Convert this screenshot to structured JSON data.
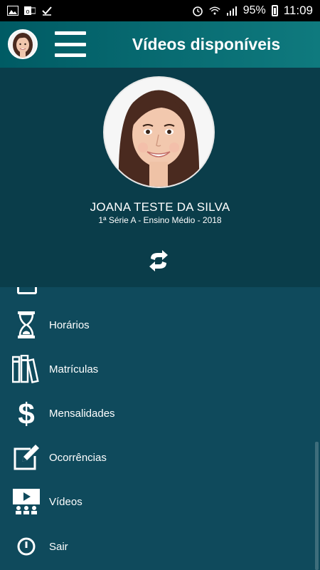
{
  "status_bar": {
    "battery": "95%",
    "time": "11:09",
    "left_icons": [
      "image-icon",
      "outlook-icon",
      "check-icon"
    ],
    "right_icons": [
      "alarm-icon",
      "wifi-icon",
      "signal-icon",
      "battery-icon"
    ]
  },
  "header": {
    "title": "Vídeos disponíveis"
  },
  "profile": {
    "name": "JOANA TESTE DA SILVA",
    "details": "1ª Série A - Ensino Médio - 2018"
  },
  "menu": {
    "items": [
      {
        "label": "Horários",
        "icon": "hourglass-icon"
      },
      {
        "label": "Matrículas",
        "icon": "books-icon"
      },
      {
        "label": "Mensalidades",
        "icon": "dollar-icon"
      },
      {
        "label": "Ocorrências",
        "icon": "edit-icon"
      },
      {
        "label": "Vídeos",
        "icon": "video-icon"
      },
      {
        "label": "Sair",
        "icon": "power-icon"
      }
    ]
  },
  "colors": {
    "header": "#005b64",
    "profile_bg": "#0a3d4a",
    "menu_bg": "#0f4a5c"
  }
}
